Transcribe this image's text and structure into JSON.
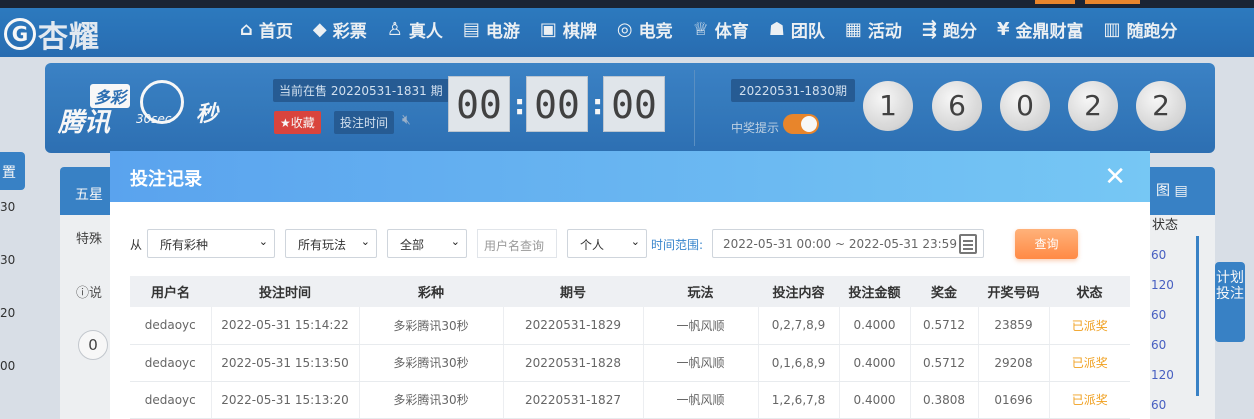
{
  "topnav": {
    "logo_text": "杏耀",
    "items": [
      {
        "icon": "home-icon",
        "glyph": "⌂",
        "label": "首页"
      },
      {
        "icon": "lottery-icon",
        "glyph": "◆",
        "label": "彩票"
      },
      {
        "icon": "live-icon",
        "glyph": "♙",
        "label": "真人"
      },
      {
        "icon": "slot-icon",
        "glyph": "▤",
        "label": "电游"
      },
      {
        "icon": "cards-icon",
        "glyph": "▣",
        "label": "棋牌"
      },
      {
        "icon": "gamepad-icon",
        "glyph": "◎",
        "label": "电竞"
      },
      {
        "icon": "trophy-icon",
        "glyph": "♕",
        "label": "体育"
      },
      {
        "icon": "team-icon",
        "glyph": "☗",
        "label": "团队"
      },
      {
        "icon": "gift-icon",
        "glyph": "▦",
        "label": "活动"
      },
      {
        "icon": "car-icon",
        "glyph": "⇶",
        "label": "跑分"
      },
      {
        "icon": "finance-icon",
        "glyph": "¥",
        "label": "金鼎财富"
      },
      {
        "icon": "running-icon",
        "glyph": "▥",
        "label": "随跑分"
      }
    ]
  },
  "lottery": {
    "logo_top": "多彩",
    "logo_main": "腾讯",
    "logo_sec": "30sec",
    "logo_unit": "秒",
    "current_issue": "当前在售 20220531-1831 期",
    "fav_label": "★收藏",
    "bet_time_label": "投注时间",
    "countdown": [
      "00",
      "00",
      "00"
    ],
    "last_issue": "20220531-1830期",
    "win_tip": "中奖提示",
    "balls": [
      "1",
      "6",
      "0",
      "2",
      "2"
    ]
  },
  "background": {
    "left_tab": "置",
    "left_values": [
      "30",
      "30",
      "20",
      "00"
    ],
    "wuxing": "五星",
    "teshu": "特殊",
    "shuo": "说",
    "zero": "0",
    "right_header": "图",
    "right_status": "状态",
    "right_values": [
      "60",
      "120",
      "60",
      "60",
      "120",
      "60"
    ],
    "plan_tab": "计划投注"
  },
  "modal": {
    "title": "投注记录",
    "close": "✕",
    "from_label": "从",
    "lottery_select": "所有彩种",
    "play_select": "所有玩法",
    "range_select": "全部",
    "username_placeholder": "用户名查询",
    "scope_select": "个人",
    "time_range_label": "时间范围:",
    "time_range_value": "2022-05-31 00:00 ~ 2022-05-31 23:59",
    "query_label": "查询",
    "columns": [
      "用户名",
      "投注时间",
      "彩种",
      "期号",
      "玩法",
      "投注内容",
      "投注金额",
      "奖金",
      "开奖号码",
      "状态"
    ],
    "rows": [
      [
        "dedaoyc",
        "2022-05-31 15:14:22",
        "多彩腾讯30秒",
        "20220531-1829",
        "一帆风顺",
        "0,2,7,8,9",
        "0.4000",
        "0.5712",
        "23859",
        "已派奖"
      ],
      [
        "dedaoyc",
        "2022-05-31 15:13:50",
        "多彩腾讯30秒",
        "20220531-1828",
        "一帆风顺",
        "0,1,6,8,9",
        "0.4000",
        "0.5712",
        "29208",
        "已派奖"
      ],
      [
        "dedaoyc",
        "2022-05-31 15:13:20",
        "多彩腾讯30秒",
        "20220531-1827",
        "一帆风顺",
        "1,2,6,7,8",
        "0.4000",
        "0.3808",
        "01696",
        "已派奖"
      ]
    ]
  }
}
